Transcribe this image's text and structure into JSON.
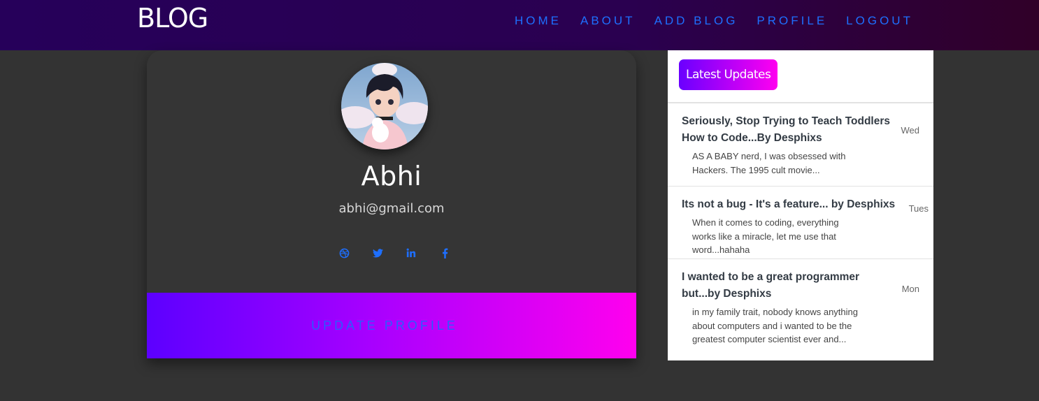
{
  "brand": "BLOG",
  "nav": [
    "HOME",
    "ABOUT",
    "ADD BLOG",
    "PROFILE",
    "LOGOUT"
  ],
  "profile": {
    "name": "Abhi",
    "email": "abhi@gmail.com",
    "socials": [
      "dribbble-icon",
      "twitter-icon",
      "linkedin-icon",
      "facebook-icon"
    ],
    "update_label": "UPDATE PROFILE"
  },
  "updates": {
    "heading": "Latest Updates",
    "items": [
      {
        "title": "Seriously, Stop Trying to Teach Toddlers How to Code...By Desphixs",
        "day": "Wed",
        "excerpt": "AS A BABY nerd, I was obsessed with Hackers. The 1995 cult movie..."
      },
      {
        "title": "Its not a bug - It's a feature... by Desphixs",
        "day": "Tues",
        "excerpt": "When it comes to coding, everything works like a miracle, let me use that word...hahaha"
      },
      {
        "title": "I wanted to be a great programmer but...by Desphixs",
        "day": "Mon",
        "excerpt": "in my family trait, nobody knows anything about computers and i wanted to be the greatest computer scientist ever and..."
      }
    ]
  },
  "colors": {
    "accent": "#1e6fff",
    "gradient_start": "#5c00ff",
    "gradient_end": "#ff00ee",
    "background": "#333333"
  }
}
